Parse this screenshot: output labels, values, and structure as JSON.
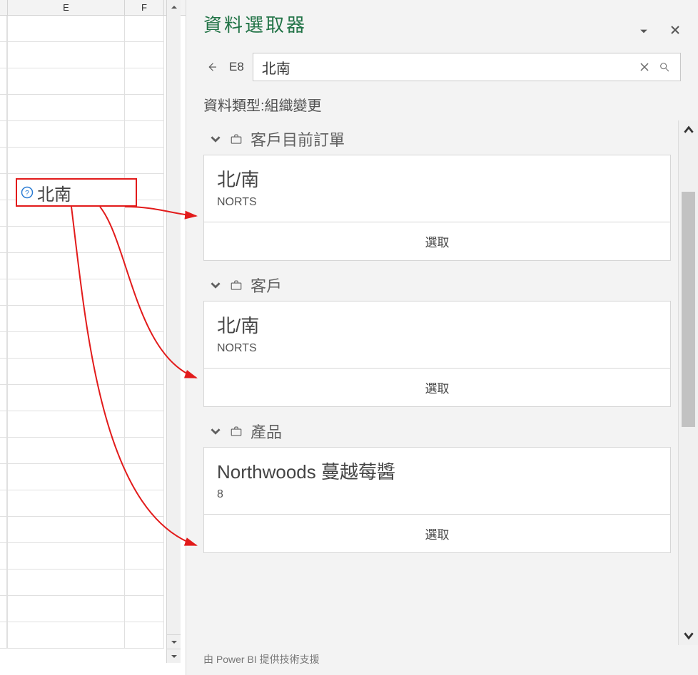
{
  "columns": {
    "e": "E",
    "f": "F"
  },
  "cell": {
    "value": "北南"
  },
  "pane": {
    "title": "資料選取器",
    "cell_ref": "E8",
    "search_value": "北南",
    "type_label": "資料類型",
    "type_value": "組織變更",
    "select_label": "選取",
    "footer": "由 Power BI 提供技術支援",
    "groups": [
      {
        "name": "客戶目前訂單",
        "title": "北/南",
        "sub": "NORTS"
      },
      {
        "name": "客戶",
        "title": "北/南",
        "sub": "NORTS"
      },
      {
        "name": "產品",
        "title": "Northwoods 蔓越莓醬",
        "sub": "8"
      }
    ]
  }
}
